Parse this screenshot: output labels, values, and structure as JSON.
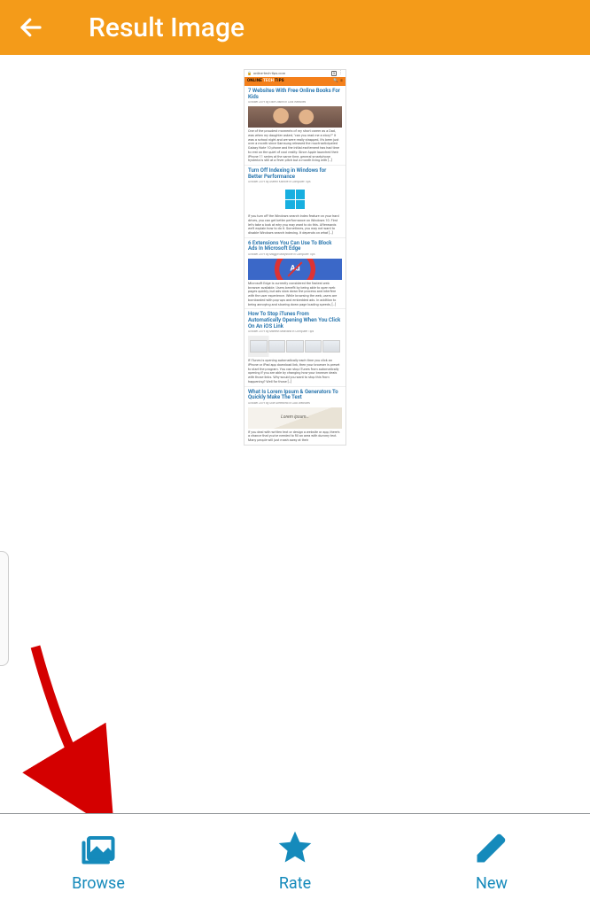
{
  "colors": {
    "accent": "#f49b19",
    "action": "#158abb",
    "arrow": "#d40000"
  },
  "appbar": {
    "title": "Result Image"
  },
  "bottom": {
    "browse": "Browse",
    "rate": "Rate",
    "new": "New"
  },
  "capture": {
    "url": "online-tech-tips.com",
    "brand_a": "ONLINE",
    "brand_b": "TECH",
    "brand_c": "TIPS",
    "articles": [
      {
        "title": "7 Websites With Free Online Books For Kids",
        "meta": "October 2019 by Elsie Otachi in Cool Websites",
        "body": "One of the proudest moments of my short career as a Dad, was when my daughter asked, \"can you read me a story?\" It was a school night and we were really strapped. It's been just over a month since Samsung released the much-anticipated Galaxy Note 10 phone and the initial excitement has had time to rest on the quiet of cool reality. Since Apple launched their iPhone 11 series at the same time, general smartphone hysteria is still at a fever pitch but a month living with […]"
      },
      {
        "title": "Turn Off Indexing in Windows for Better Performance",
        "meta": "October 2019 by Aseem Kishore in Computer Tips",
        "body": "If you turn off the Windows search index feature on your hard drives, you can get better performance on Windows 10. First let's take a look at why you may want to do this. Afterwards we'll explain how to do it. Sometimes, you may not want to disable Windows search indexing. It depends on what […]"
      },
      {
        "title": "6 Extensions You Can Use To Block Ads In Microsoft Edge",
        "meta": "October 2019 by Maggie Marystone in Computer Tips",
        "body": "Microsoft Edge is currently considered the fastest web browser available. Users benefit by being able to open web pages quickly, but ads slow down the process and interfere with the user experience. While browsing the web, users are bombarded with pop-ups and embedded ads. In addition to being annoying and slowing down page loading speeds, […]"
      },
      {
        "title": "How To Stop iTunes From Automatically Opening When You Click On An iOS Link",
        "meta": "October 2019 by Mahesh Makvana in Computer Tips",
        "body": "If iTunes is opening automatically each time you click an iPhone or iPad app download link, then your browser is preset to start the program. You can stop iTunes from automatically opening if you are able by changing how your browser deals with those links. Why would you want to stop this from happening? Well for those […]"
      },
      {
        "title": "What Is Lorem Ipsum & Generators To Quickly Make The Text",
        "meta": "October 2019 by Ollie Greenfield in Cool Websites",
        "body": "If you deal with written text or design a website or app, there's a chance that you've needed to fill an area with dummy text. Many people will just mash away at their"
      }
    ]
  }
}
